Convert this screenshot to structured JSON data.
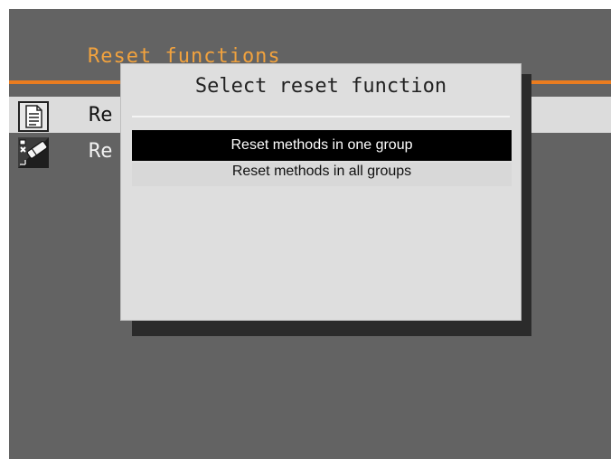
{
  "screen": {
    "header": {
      "title": "Reset functions"
    },
    "rows": [
      {
        "label": "Re",
        "icon": "document-icon",
        "selected": true
      },
      {
        "label": "Re",
        "icon": "eraser-icon",
        "selected": false
      }
    ]
  },
  "dialog": {
    "title": "Select reset function",
    "options": [
      {
        "label": "Reset methods in one group",
        "selected": true
      },
      {
        "label": "Reset methods in all groups",
        "selected": false
      }
    ]
  },
  "colors": {
    "background": "#636363",
    "accent": "#ea7c1f",
    "header_text": "#f1a23e",
    "selected_row": "#dcdcdc",
    "dialog_bg": "#dedede",
    "highlight": "#000000"
  }
}
